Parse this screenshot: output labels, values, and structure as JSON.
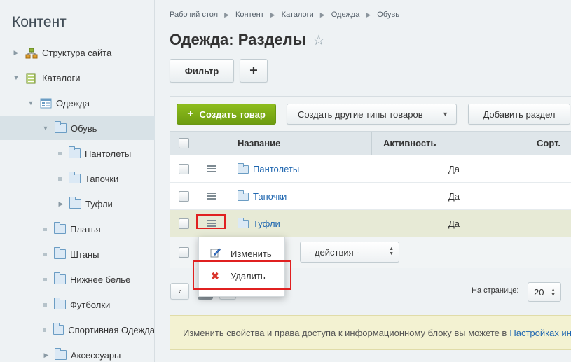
{
  "sidebar": {
    "title": "Контент",
    "items": [
      {
        "label": "Структура сайта"
      },
      {
        "label": "Каталоги"
      },
      {
        "label": "Одежда"
      },
      {
        "label": "Обувь"
      },
      {
        "label": "Пантолеты"
      },
      {
        "label": "Тапочки"
      },
      {
        "label": "Туфли"
      },
      {
        "label": "Платья"
      },
      {
        "label": "Штаны"
      },
      {
        "label": "Нижнее белье"
      },
      {
        "label": "Футболки"
      },
      {
        "label": "Спортивная Одежда"
      },
      {
        "label": "Аксессуары"
      }
    ]
  },
  "breadcrumb": [
    "Рабочий стол",
    "Контент",
    "Каталоги",
    "Одежда",
    "Обувь"
  ],
  "page_title": "Одежда: Разделы",
  "toolbar": {
    "filter_label": "Фильтр",
    "add_label": "+"
  },
  "grid_toolbar": {
    "create_product": "Создать товар",
    "create_other": "Создать другие типы товаров",
    "add_section": "Добавить раздел"
  },
  "columns": [
    "Название",
    "Активность",
    "Сорт."
  ],
  "rows": [
    {
      "name": "Пантолеты",
      "active": "Да"
    },
    {
      "name": "Тапочки",
      "active": "Да"
    },
    {
      "name": "Туфли",
      "active": "Да"
    }
  ],
  "actions_select": "- действия -",
  "context_menu": {
    "edit": "Изменить",
    "delete": "Удалить"
  },
  "pagination": {
    "per_page_label": "На странице:",
    "per_page_value": "20"
  },
  "info": {
    "text": "Изменить свойства и права доступа к информационному блоку вы можете в",
    "link": "Настройках ин"
  },
  "colors": {
    "accent_green": "#7aa818",
    "link": "#2067b0",
    "highlight_red": "#e02020"
  }
}
